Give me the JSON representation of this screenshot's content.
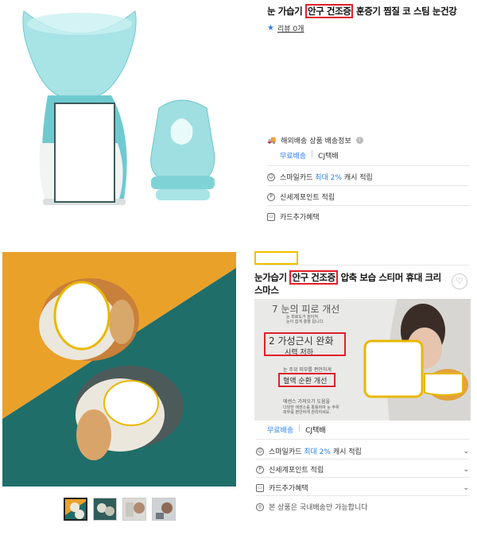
{
  "top_product": {
    "title_prefix": "눈 가습기 ",
    "title_highlight": "안구 건조증",
    "title_suffix": " 훈증기 찜질 코 스팀 눈건강",
    "rating_label": "리뷰 0개",
    "shipping": {
      "heading": "해외배송 상품 배송정보",
      "free_label": "무료배송",
      "carrier": "CJ택배"
    },
    "benefits": [
      {
        "pre": "스마일카드 ",
        "accent": "최대 2%",
        "post": " 캐시 적립",
        "icon": "smile-card-icon"
      },
      {
        "pre": "신세계포인트 적립",
        "accent": "",
        "post": "",
        "icon": "point-icon"
      },
      {
        "pre": "카드추가혜택",
        "accent": "",
        "post": "",
        "icon": "card-icon"
      }
    ]
  },
  "bottom_product": {
    "title_prefix": "눈가습기 ",
    "title_highlight": "안구 건조증",
    "title_suffix": " 압축 보습 스티머 휴대 크리스마스",
    "banner": {
      "line1": "7 눈의 피로 개선",
      "line1_sub": "눈 피로도가 높아져\n눈이 쉽게 충혈 됩니다.",
      "line2": "2 가성근시 완화",
      "line2_sub": "시력 저하",
      "line3_head": "눈 주위 피부를 편안하게",
      "line3": "혈액 순환 개선",
      "line4": "에센스 가져오기 도움을",
      "line4_sub": "다양한 에센스를 활용하여 눈 주위\n피부를 편안하게 관리하세요."
    },
    "shipping": {
      "free_label": "무료배송",
      "carrier": "CJ택배"
    },
    "benefits": [
      {
        "pre": "스마일카드 ",
        "accent": "최대 2%",
        "post": " 캐시 적립",
        "icon": "smile-card-icon"
      },
      {
        "pre": "신세계포인트 적립",
        "accent": "",
        "post": "",
        "icon": "point-icon"
      },
      {
        "pre": "카드추가혜택",
        "accent": "",
        "post": "",
        "icon": "card-icon"
      }
    ],
    "notice": "본 상품은 국내배송만 가능합니다"
  },
  "colors": {
    "accent_blue": "#2d7ff0",
    "highlight_red": "#e0202a",
    "annotation_yellow": "#f0c000",
    "photo_orange": "#e9a12a",
    "photo_teal": "#1f6e6a"
  }
}
